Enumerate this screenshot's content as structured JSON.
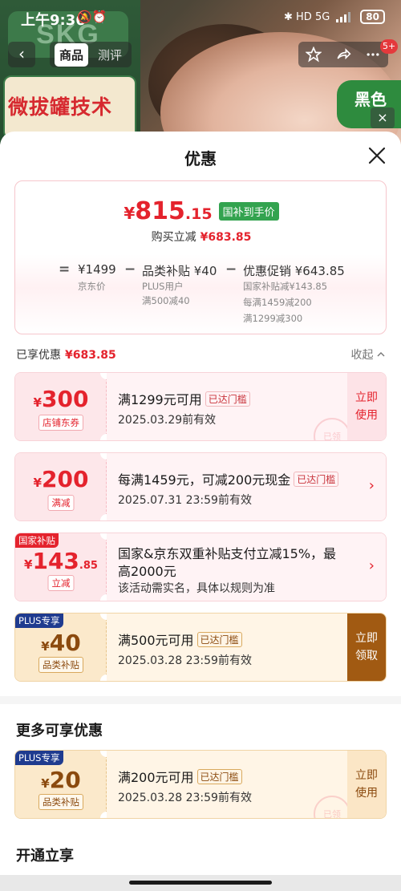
{
  "status_bar": {
    "time": "上午9:36",
    "icons": "🔕⏰",
    "right_icons": "✱ HD 5G",
    "battery": "80"
  },
  "nav": {
    "back": "‹",
    "tabs": [
      "商品",
      "测评"
    ],
    "badge": "5+"
  },
  "background": {
    "brand": "SKG",
    "banner": "微拔罐技术",
    "badge": "黑色"
  },
  "sheet": {
    "title": "优惠",
    "summary": {
      "currency": "¥",
      "price_int": "815",
      "price_dec": ".15",
      "tag": "国补到手价",
      "sub_label": "购买立减",
      "sub_value": "¥683.85",
      "formula": {
        "eq": "=",
        "minus": "−",
        "jd_price": "¥1499",
        "jd_label": "京东价",
        "cat_subsidy": "品类补贴 ¥40",
        "cat_note1": "PLUS用户",
        "cat_note2": "满500减40",
        "promo": "优惠促销 ¥643.85",
        "promo_note1": "国家补贴减¥143.85",
        "promo_note2": "每满1459减200",
        "promo_note3": "满1299减300"
      }
    },
    "enjoyed_label": "已享优惠",
    "enjoyed_value": "¥683.85",
    "collapse_label": "收起",
    "coupons": [
      {
        "yen": "¥",
        "amount": "300",
        "tag": "店铺东券",
        "line1": "满1299元可用",
        "reach": "已达门槛",
        "line2": "2025.03.29前有效",
        "action": "立即使用",
        "stamp": "已领"
      },
      {
        "yen": "¥",
        "amount": "200",
        "tag": "满减",
        "line1": "每满1459元，可减200元现金",
        "reach": "已达门槛",
        "line2": "2025.07.31 23:59前有效"
      },
      {
        "ribbon": "国家补贴",
        "yen": "¥",
        "amount": "143",
        "decimal": ".85",
        "tag": "立减",
        "line1": "国家&京东双重补贴支付立减15%，最",
        "line1b": "高2000元",
        "line2": "该活动需实名，具体以规则为准"
      },
      {
        "ribbon": "PLUS专享",
        "yen": "¥",
        "amount": "40",
        "tag": "品类补贴",
        "line1": "满500元可用",
        "reach": "已达门槛",
        "line2": "2025.03.28 23:59前有效",
        "action": "立即领取"
      }
    ],
    "more_title": "更多可享优惠",
    "more_coupons": [
      {
        "ribbon": "PLUS专享",
        "yen": "¥",
        "amount": "20",
        "tag": "品类补贴",
        "line1": "满200元可用",
        "reach": "已达门槛",
        "line2": "2025.03.28 23:59前有效",
        "action": "立即使用",
        "stamp": "已领"
      }
    ],
    "open_title": "开通立享"
  },
  "colors": {
    "accent_red": "#e4232d",
    "green_tag": "#33a34f",
    "plus_blue": "#1f3b8f",
    "gold_dark": "#a15a12"
  }
}
